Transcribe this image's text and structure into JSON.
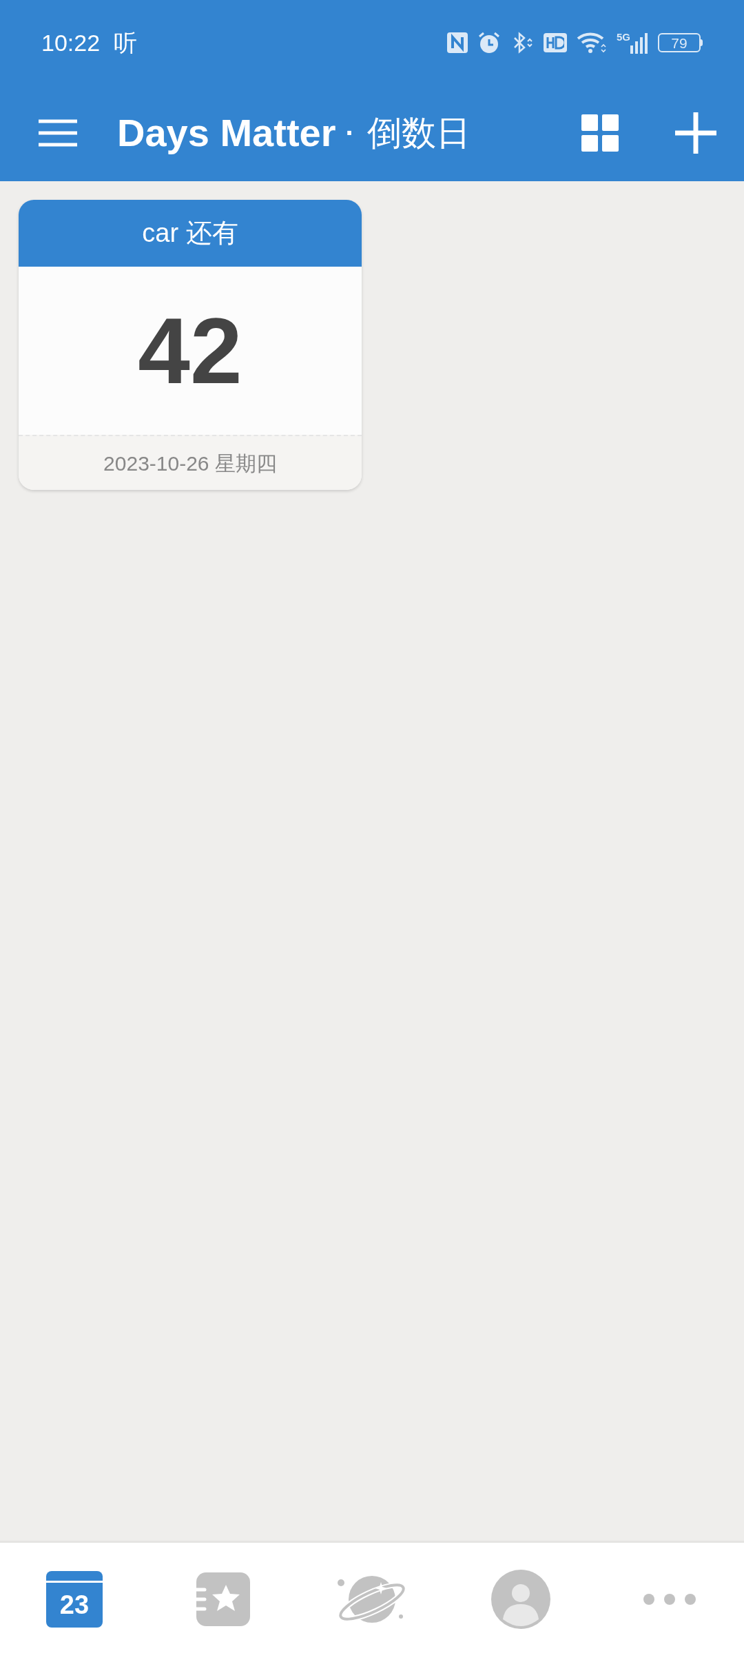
{
  "status_bar": {
    "time": "10:22",
    "app_glyph": "听",
    "network": "5G",
    "battery": "79"
  },
  "header": {
    "title": "Days Matter",
    "separator": "·",
    "subtitle": "倒数日"
  },
  "cards": [
    {
      "title": "car 还有",
      "days": "42",
      "date": "2023-10-26 星期四"
    }
  ],
  "bottom_nav": [
    {
      "kind": "calendar",
      "label": "23",
      "selected": true
    },
    {
      "kind": "notebook",
      "selected": false
    },
    {
      "kind": "planet",
      "selected": false
    },
    {
      "kind": "profile",
      "selected": false
    },
    {
      "kind": "more",
      "selected": false
    }
  ]
}
